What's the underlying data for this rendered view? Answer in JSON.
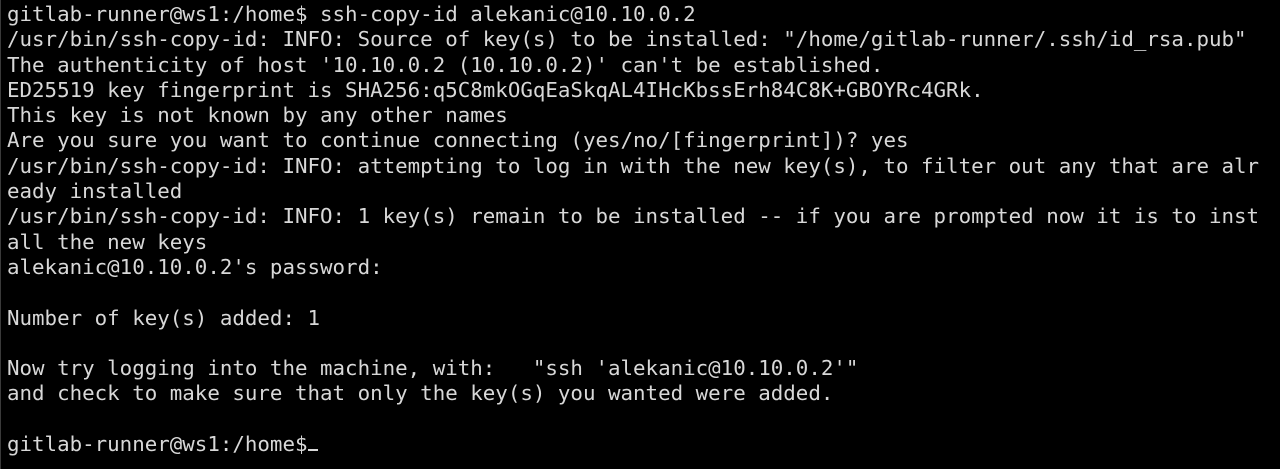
{
  "terminal": {
    "lines": [
      "gitlab-runner@ws1:/home$ ssh-copy-id alekanic@10.10.0.2",
      "/usr/bin/ssh-copy-id: INFO: Source of key(s) to be installed: \"/home/gitlab-runner/.ssh/id_rsa.pub\"",
      "The authenticity of host '10.10.0.2 (10.10.0.2)' can't be established.",
      "ED25519 key fingerprint is SHA256:q5C8mkOGqEaSkqAL4IHcKbssErh84C8K+GBOYRc4GRk.",
      "This key is not known by any other names",
      "Are you sure you want to continue connecting (yes/no/[fingerprint])? yes",
      "/usr/bin/ssh-copy-id: INFO: attempting to log in with the new key(s), to filter out any that are alr",
      "eady installed",
      "/usr/bin/ssh-copy-id: INFO: 1 key(s) remain to be installed -- if you are prompted now it is to inst",
      "all the new keys",
      "alekanic@10.10.0.2's password:",
      "",
      "Number of key(s) added: 1",
      "",
      "Now try logging into the machine, with:   \"ssh 'alekanic@10.10.0.2'\"",
      "and check to make sure that only the key(s) you wanted were added.",
      "",
      "gitlab-runner@ws1:/home$"
    ]
  }
}
